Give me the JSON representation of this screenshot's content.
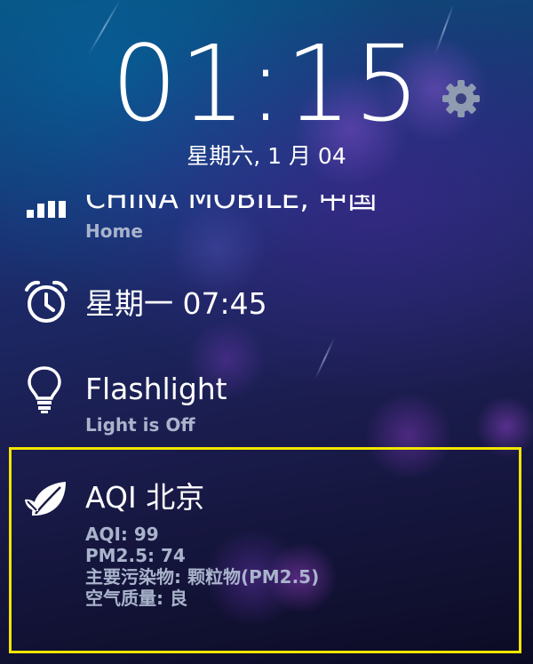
{
  "lockscreen": {
    "time": "01:15",
    "date": "星期六, 1 月 04",
    "settings_icon": "gear-icon"
  },
  "network": {
    "icon": "signal-bars-icon",
    "title": "CHINA MOBILE, 中国",
    "subtitle": "Home"
  },
  "alarm": {
    "icon": "alarm-clock-icon",
    "title": "星期一 07:45"
  },
  "flashlight": {
    "icon": "lightbulb-icon",
    "title": "Flashlight",
    "subtitle": "Light is Off"
  },
  "aqi": {
    "icon": "leaf-icon",
    "title": "AQI 北京",
    "lines": [
      "AQI: 99",
      "PM2.5: 74",
      "主要污染物: 颗粒物(PM2.5)",
      "空气质量: 良"
    ],
    "highlight_color": "#f2e600"
  }
}
